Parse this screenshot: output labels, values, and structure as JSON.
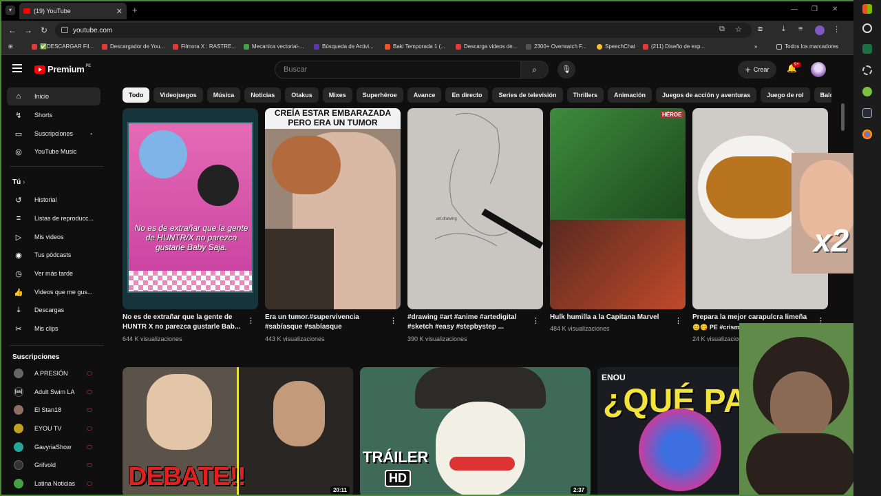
{
  "browser": {
    "tab_title": "(19) YouTube",
    "url": "youtube.com",
    "bookmarks": [
      {
        "label": "✅DESCARGAR Fil...",
        "color": "#e53935"
      },
      {
        "label": "Descargador de You...",
        "color": "#e53935"
      },
      {
        "label": "Filmora X : RASTRE...",
        "color": "#e53935"
      },
      {
        "label": "Mecanica vectorial-...",
        "color": "#43a047"
      },
      {
        "label": "Búsqueda de Activi...",
        "color": "#5e35b1"
      },
      {
        "label": "Baki Temporada 1 (...",
        "color": "#f4511e"
      },
      {
        "label": "Descarga videos de...",
        "color": "#e53935"
      },
      {
        "label": "2300+ Overwatch F...",
        "color": "#555555"
      },
      {
        "label": "SpeechChat",
        "color": "#fbc02d"
      },
      {
        "label": "(211) Diseño de exp...",
        "color": "#e53935"
      }
    ],
    "all_bookmarks": "Todos los marcadores"
  },
  "header": {
    "logo_text": "Premium",
    "logo_sup": "PE",
    "search_placeholder": "Buscar",
    "create_label": "Crear",
    "notif_count": "9+"
  },
  "sidebar": {
    "main": [
      {
        "label": "Inicio",
        "icon": "home-icon",
        "glyph": "⌂"
      },
      {
        "label": "Shorts",
        "icon": "shorts-icon",
        "glyph": "↯"
      },
      {
        "label": "Suscripciones",
        "icon": "subscriptions-icon",
        "glyph": "▭"
      },
      {
        "label": "YouTube Music",
        "icon": "music-icon",
        "glyph": "◎"
      }
    ],
    "you_label": "Tú",
    "you": [
      {
        "label": "Historial",
        "icon": "history-icon",
        "glyph": "↺"
      },
      {
        "label": "Listas de reproducc...",
        "icon": "playlists-icon",
        "glyph": "≡"
      },
      {
        "label": "Mis videos",
        "icon": "my-videos-icon",
        "glyph": "▷"
      },
      {
        "label": "Tus pódcasts",
        "icon": "podcasts-icon",
        "glyph": "◉"
      },
      {
        "label": "Ver más tarde",
        "icon": "watch-later-icon",
        "glyph": "◷"
      },
      {
        "label": "Videos que me gus...",
        "icon": "liked-icon",
        "glyph": "👍"
      },
      {
        "label": "Descargas",
        "icon": "downloads-icon",
        "glyph": "⤓"
      },
      {
        "label": "Mis clips",
        "icon": "clips-icon",
        "glyph": "✂"
      }
    ],
    "subs_label": "Suscripciones",
    "subs": [
      {
        "label": "A PRESIÓN",
        "color": "#666666"
      },
      {
        "label": "Adult Swim LA",
        "color": "#111111"
      },
      {
        "label": "El Stan18",
        "color": "#8d6e63"
      },
      {
        "label": "EYOU TV",
        "color": "#c0a020"
      },
      {
        "label": "GavyriaShow",
        "color": "#26a69a"
      },
      {
        "label": "Grifvold",
        "color": "#333333"
      },
      {
        "label": "Latina Noticias",
        "color": "#43a047"
      }
    ]
  },
  "chips": [
    "Todo",
    "Videojuegos",
    "Música",
    "Noticias",
    "Otakus",
    "Mixes",
    "Superhéroe",
    "Avance",
    "En directo",
    "Series de televisión",
    "Thrillers",
    "Animación",
    "Juegos de acción y aventuras",
    "Juego de rol",
    "Balón"
  ],
  "shorts": [
    {
      "title": "No es de extrañar que la gente de HUNTR X no parezca gustarle Bab...",
      "views": "644 K visualizaciones",
      "caption": "No es de extrañar que la gente de HUNTR/X no parezca gustarle Baby Saja."
    },
    {
      "title": "Era un tumor.#supervivencia #sabíasque #sabíasque",
      "views": "443 K visualizaciones",
      "caption": "CREÍA ESTAR EMBARAZADA PERO ERA UN TUMOR"
    },
    {
      "title": "#drawing #art #anime #artedigital #sketch #easy #stepbystep ...",
      "views": "390 K visualizaciones",
      "caption": "art.drawing"
    },
    {
      "title": "Hulk humilla a la Capitana Marvel",
      "views": "484 K visualizaciones",
      "caption": "HÉROE"
    },
    {
      "title": "Prepara la mejor carapulcra limeña",
      "title2": "😊😋 PE #crism",
      "views": "24 K visualizaciones",
      "caption": "x2"
    }
  ],
  "videos": [
    {
      "overlay": "DEBATE!!",
      "duration": "20:11"
    },
    {
      "overlay": "TRÁILER",
      "overlay2": "HD",
      "duration": "2:37"
    },
    {
      "overlay": "¿QUÉ PA",
      "overlay_top": "ENOU"
    }
  ]
}
